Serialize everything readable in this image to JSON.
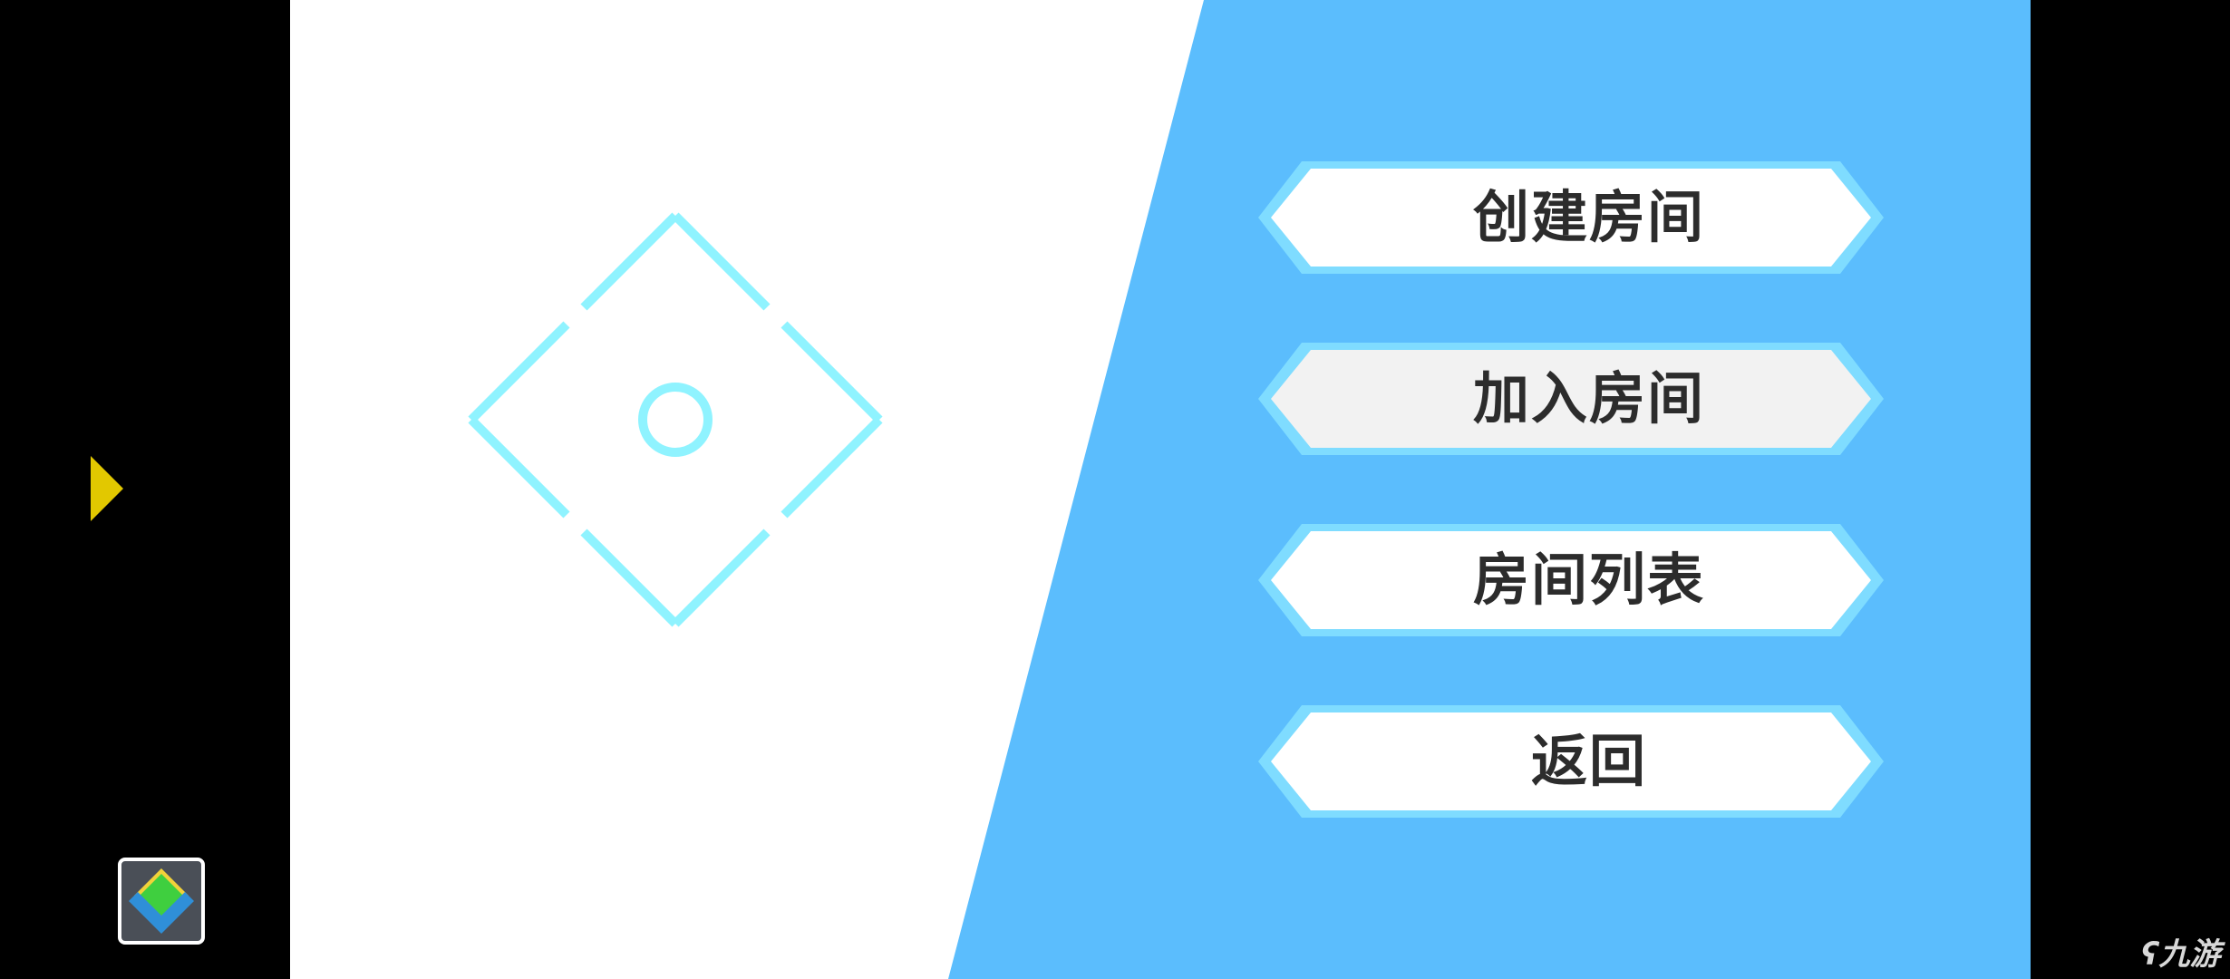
{
  "menu": {
    "items": [
      {
        "label": "创建房间",
        "highlighted": false
      },
      {
        "label": "加入房间",
        "highlighted": true
      },
      {
        "label": "房间列表",
        "highlighted": false
      },
      {
        "label": "返回",
        "highlighted": false
      }
    ]
  },
  "watermark": {
    "text": "九游"
  },
  "icons": {
    "side_arrow": "play-triangle-icon",
    "app": "layered-diamond-app-icon",
    "crosshair": "diamond-crosshair-icon"
  },
  "colors": {
    "panel_blue": "#5bbdfd",
    "button_border": "#7fdcff",
    "button_fill": "#ffffff",
    "button_highlight_fill": "#f2f2f2",
    "crosshair": "#8ff3ff",
    "arrow_yellow": "#e2c800",
    "label_text": "#2c2c2c"
  }
}
